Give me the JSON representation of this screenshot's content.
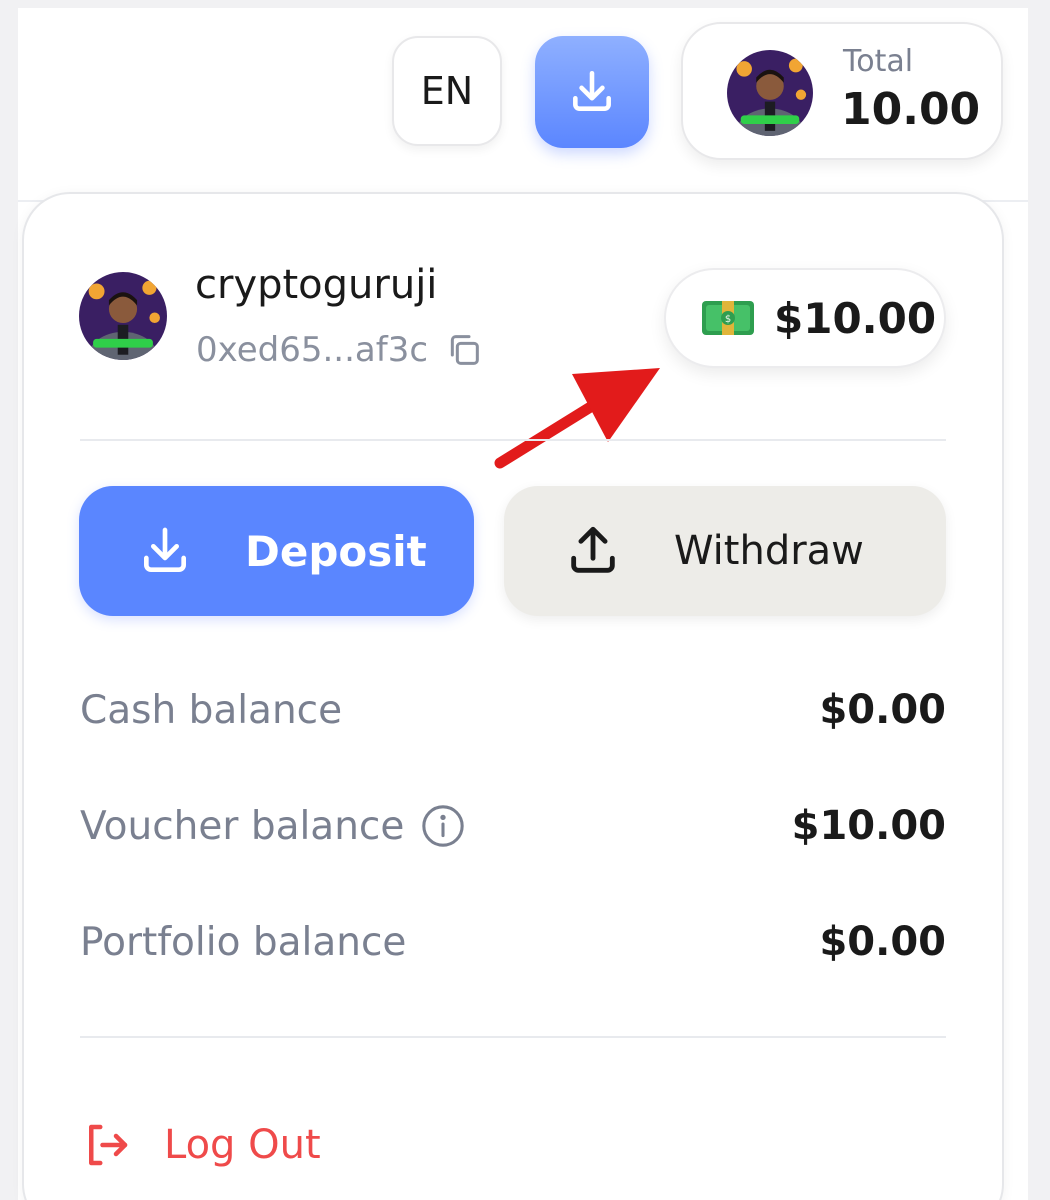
{
  "header": {
    "language_label": "EN",
    "total_label": "Total",
    "total_value": "10.00"
  },
  "profile": {
    "username": "cryptoguruji",
    "wallet_address": "0xed65...af3c"
  },
  "balance_pill": {
    "value": "$10.00"
  },
  "actions": {
    "deposit_label": "Deposit",
    "withdraw_label": "Withdraw"
  },
  "balances": [
    {
      "label": "Cash balance",
      "value": "$0.00"
    },
    {
      "label": "Voucher balance",
      "value": "$10.00"
    },
    {
      "label": "Portfolio balance",
      "value": "$0.00"
    }
  ],
  "logout_label": "Log Out",
  "colors": {
    "primary_blue": "#5a86ff",
    "logout_red": "#ef4a4a",
    "annotation_red": "#e21b1b"
  }
}
